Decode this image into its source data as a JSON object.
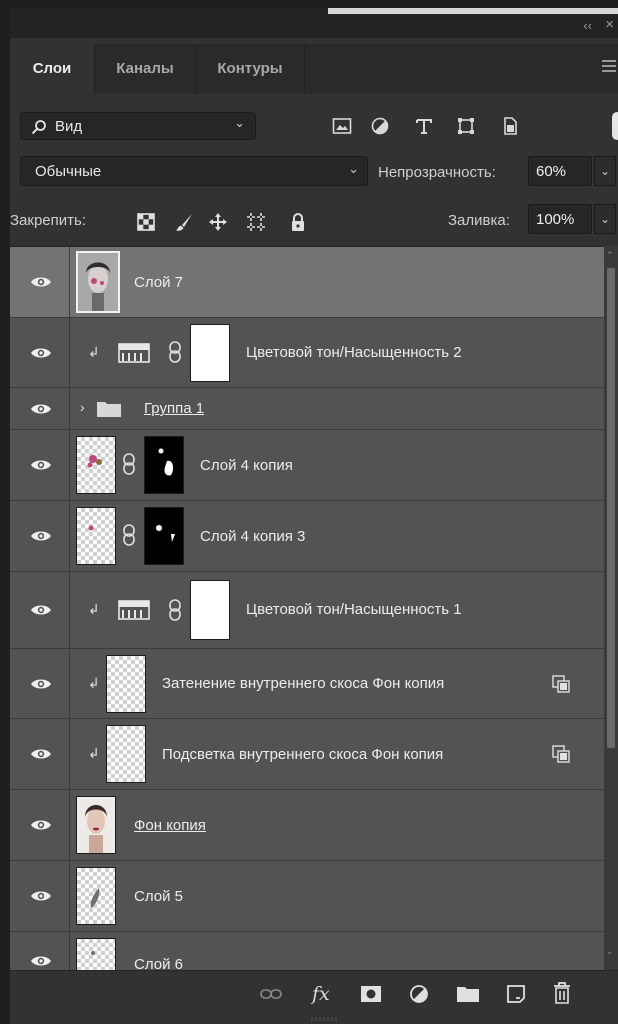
{
  "window": {
    "collapse_label": "‹‹",
    "close_label": "×"
  },
  "tabs": [
    {
      "label": "Слои",
      "active": true
    },
    {
      "label": "Каналы",
      "active": false
    },
    {
      "label": "Контуры",
      "active": false
    }
  ],
  "filter": {
    "search_icon": "⌕",
    "kind_label": "Вид",
    "icons": [
      "image-filter-icon",
      "adjustment-filter-icon",
      "type-filter-icon",
      "shape-filter-icon",
      "smart-object-filter-icon"
    ]
  },
  "blend": {
    "mode": "Обычные",
    "opacity_label": "Непрозрачность:",
    "opacity_value": "60%"
  },
  "lock": {
    "label": "Закрепить:",
    "fill_label": "Заливка:",
    "fill_value": "100%"
  },
  "layers": [
    {
      "name": "Слой 7",
      "type": "pixel",
      "selected": true,
      "underline": false
    },
    {
      "name": "Цветовой тон/Насыщенность 2",
      "type": "adjustment",
      "clipped": true
    },
    {
      "name": "Группа 1",
      "type": "group",
      "underline": true
    },
    {
      "name": "Слой 4 копия",
      "type": "pixel-mask"
    },
    {
      "name": "Слой 4 копия 3",
      "type": "pixel-mask"
    },
    {
      "name": "Цветовой тон/Насыщенность 1",
      "type": "adjustment",
      "clipped": true
    },
    {
      "name": "Затенение внутреннего скоса Фон копия",
      "type": "pixel",
      "clipped": true,
      "smart": true
    },
    {
      "name": "Подсветка внутреннего скоса Фон копия",
      "type": "pixel",
      "clipped": true,
      "smart": true
    },
    {
      "name": "Фон копия",
      "type": "pixel",
      "underline": true
    },
    {
      "name": "Слой 5",
      "type": "pixel"
    },
    {
      "name": "Слой 6",
      "type": "pixel"
    }
  ],
  "bottom_icons": [
    "link-layers-icon",
    "fx-icon",
    "add-mask-icon",
    "new-adjustment-icon",
    "new-group-icon",
    "new-layer-icon",
    "delete-layer-icon"
  ],
  "bottom": {
    "fx_label": "fx"
  }
}
